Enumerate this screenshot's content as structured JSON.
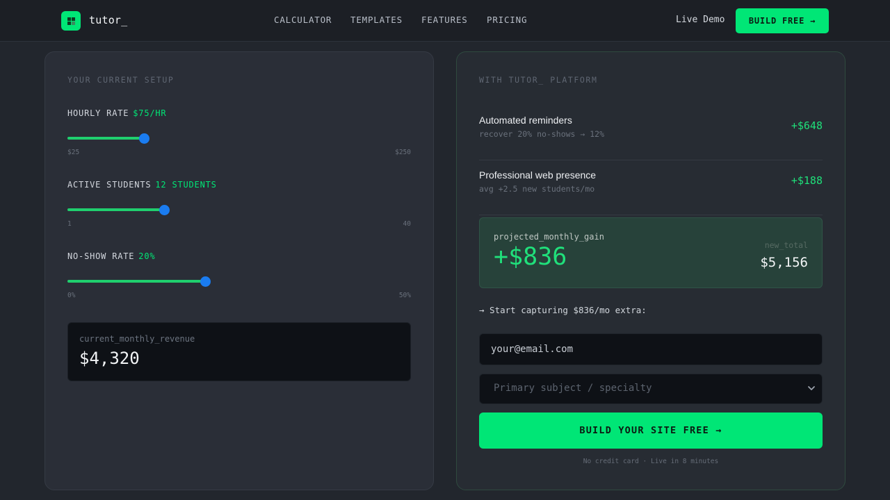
{
  "nav": {
    "logo_text": "tutor_",
    "links": [
      "CALCULATOR",
      "TEMPLATES",
      "FEATURES",
      "PRICING"
    ],
    "live_demo": "Live Demo",
    "build_free": "BUILD FREE →"
  },
  "current": {
    "section_title": "YOUR CURRENT SETUP",
    "sliders": [
      {
        "label": "HOURLY RATE",
        "value_text": "$75/HR",
        "min_label": "$25",
        "max_label": "$250",
        "value": 75,
        "min": 25,
        "max": 250
      },
      {
        "label": "ACTIVE STUDENTS",
        "value_text": "12 STUDENTS",
        "min_label": "1",
        "max_label": "40",
        "value": 12,
        "min": 1,
        "max": 40
      },
      {
        "label": "NO-SHOW RATE",
        "value_text": "20%",
        "min_label": "0%",
        "max_label": "50%",
        "value": 20,
        "min": 0,
        "max": 50
      }
    ],
    "revenue_label": "current_monthly_revenue",
    "revenue_value": "$4,320"
  },
  "platform": {
    "section_title": "WITH TUTOR_ PLATFORM",
    "benefits": [
      {
        "title": "Automated reminders",
        "sub": "recover 20% no-shows → 12%",
        "amount": "+$648"
      },
      {
        "title": "Professional web presence",
        "sub": "avg +2.5 new students/mo",
        "amount": "+$188"
      }
    ],
    "gain_label": "projected_monthly_gain",
    "gain_value": "+$836",
    "total_label": "new_total",
    "total_value": "$5,156",
    "cta_text": "→ Start capturing $836/mo extra:",
    "email_placeholder": "your@email.com",
    "subject_placeholder": "Primary subject / specialty",
    "submit_label": "BUILD YOUR SITE FREE →",
    "fineprint": "No credit card · Live in 8 minutes"
  },
  "colors": {
    "accent": "#00e676",
    "slider_thumb": "#1a7cf0",
    "background": "#22262d"
  },
  "icons": {
    "logo": "grid-logo-icon",
    "select": "chevron-down-icon"
  }
}
